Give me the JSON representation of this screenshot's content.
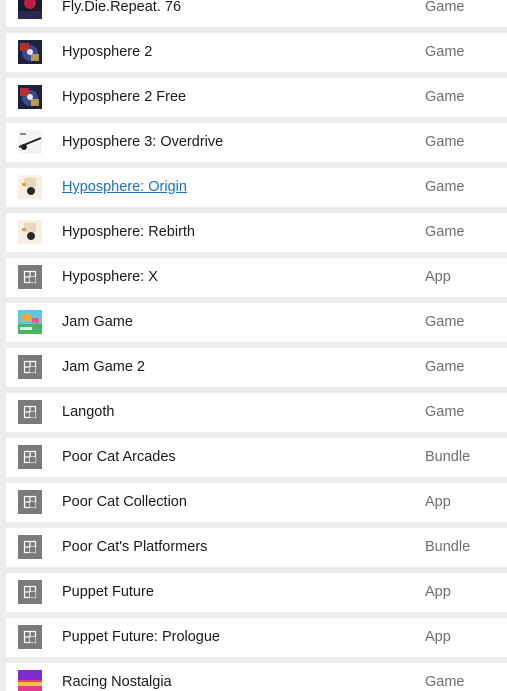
{
  "items": [
    {
      "name": "Fly.Die.Repeat. 76",
      "type": "Game",
      "icon": "fly-die-repeat-thumbnail-icon"
    },
    {
      "name": "Hyposphere 2",
      "type": "Game",
      "icon": "hyposphere-2-thumbnail-icon"
    },
    {
      "name": "Hyposphere 2 Free",
      "type": "Game",
      "icon": "hyposphere-2-free-thumbnail-icon"
    },
    {
      "name": "Hyposphere 3: Overdrive",
      "type": "Game",
      "icon": "hyposphere-3-thumbnail-icon"
    },
    {
      "name": "Hyposphere: Origin",
      "type": "Game",
      "icon": "hyposphere-origin-thumbnail-icon",
      "link": true
    },
    {
      "name": "Hyposphere: Rebirth",
      "type": "Game",
      "icon": "hyposphere-rebirth-thumbnail-icon"
    },
    {
      "name": "Hyposphere: X",
      "type": "App",
      "icon": "placeholder-app-icon"
    },
    {
      "name": "Jam Game",
      "type": "Game",
      "icon": "jam-game-thumbnail-icon"
    },
    {
      "name": "Jam Game 2",
      "type": "Game",
      "icon": "placeholder-app-icon"
    },
    {
      "name": "Langoth",
      "type": "Game",
      "icon": "placeholder-app-icon"
    },
    {
      "name": "Poor Cat Arcades",
      "type": "Bundle",
      "icon": "placeholder-app-icon"
    },
    {
      "name": "Poor Cat Collection",
      "type": "App",
      "icon": "placeholder-app-icon"
    },
    {
      "name": "Poor Cat's Platformers",
      "type": "Bundle",
      "icon": "placeholder-app-icon"
    },
    {
      "name": "Puppet Future",
      "type": "App",
      "icon": "placeholder-app-icon"
    },
    {
      "name": "Puppet Future: Prologue",
      "type": "App",
      "icon": "placeholder-app-icon"
    },
    {
      "name": "Racing Nostalgia",
      "type": "Game",
      "icon": "racing-nostalgia-thumbnail-icon"
    }
  ],
  "colors": {
    "link": "#1f6fc2",
    "row_background": "#ffffff",
    "separator": "#ececec",
    "placeholder_icon": "#7a7a7a"
  }
}
